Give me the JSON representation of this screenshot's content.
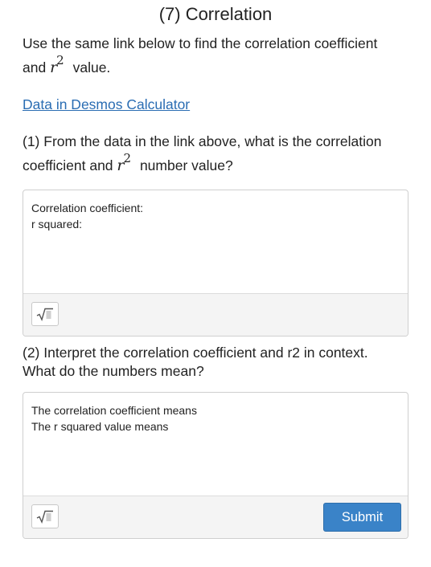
{
  "title": "(7) Correlation",
  "intro": {
    "line1": "Use the same link below to find the correlation coefficient",
    "prefix": "and",
    "math_var": "r",
    "math_sup": "2",
    "suffix": "value."
  },
  "link": {
    "label": "Data in Desmos Calculator"
  },
  "question1": {
    "line1": "(1) From the data in the link above, what is the correlation",
    "prefix": "coefficient and",
    "math_var": "r",
    "math_sup": "2",
    "suffix": "number value?",
    "answer_text": "Correlation coefficient:\nr squared:",
    "math_icon": "sqrt-icon"
  },
  "question2": {
    "line1": "(2) Interpret the correlation coefficient and r2 in context.",
    "line2": "What do the numbers mean?",
    "answer_text": "The correlation coefficient means\nThe r squared value means",
    "math_icon": "sqrt-icon",
    "submit_label": "Submit"
  },
  "colors": {
    "link": "#2a6db3",
    "submit_bg": "#3a83c8",
    "toolbar_bg": "#f4f4f4"
  }
}
